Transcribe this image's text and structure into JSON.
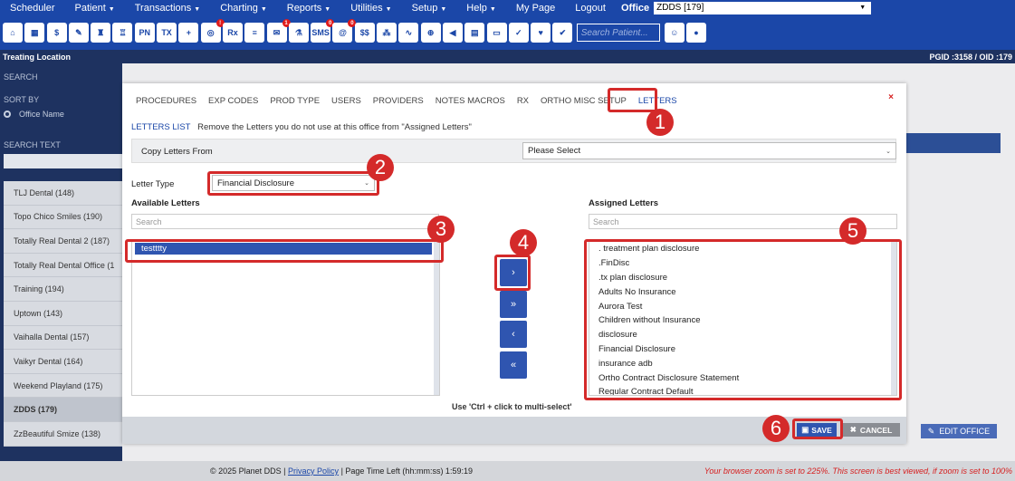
{
  "nav": {
    "items": [
      "Scheduler",
      "Patient",
      "Transactions",
      "Charting",
      "Reports",
      "Utilities",
      "Setup",
      "Help",
      "My Page",
      "Logout"
    ],
    "has_caret": [
      false,
      true,
      true,
      true,
      true,
      true,
      true,
      true,
      false,
      false
    ],
    "office_label": "Office",
    "office_value": "ZDDS [179]"
  },
  "toolbar": {
    "icons": [
      {
        "name": "home-icon",
        "glyph": "⌂"
      },
      {
        "name": "calendar-icon",
        "glyph": "▦"
      },
      {
        "name": "dollar-icon",
        "glyph": "$"
      },
      {
        "name": "edit-icon",
        "glyph": "✎"
      },
      {
        "name": "tooth-icon",
        "glyph": "♜"
      },
      {
        "name": "tooth-chart-icon",
        "glyph": "♖"
      },
      {
        "name": "pn-icon",
        "glyph": "PN"
      },
      {
        "name": "tx-icon",
        "glyph": "TX"
      },
      {
        "name": "add-person-icon",
        "glyph": "+"
      },
      {
        "name": "globe-icon",
        "glyph": "◎",
        "badge": "!"
      },
      {
        "name": "rx-icon",
        "glyph": "Rx"
      },
      {
        "name": "notes-icon",
        "glyph": "≡"
      },
      {
        "name": "messages-icon",
        "glyph": "✉",
        "badge": "1"
      },
      {
        "name": "lab-icon",
        "glyph": "⚗"
      },
      {
        "name": "sms-icon",
        "glyph": "SMS",
        "badge": "0"
      },
      {
        "name": "online-icon",
        "glyph": "@",
        "badge": "0"
      },
      {
        "name": "payments-icon",
        "glyph": "$$"
      },
      {
        "name": "network-icon",
        "glyph": "⁂"
      },
      {
        "name": "analytics-icon",
        "glyph": "∿"
      },
      {
        "name": "support-icon",
        "glyph": "⊕"
      },
      {
        "name": "marketing-icon",
        "glyph": "◀"
      },
      {
        "name": "print-icon",
        "glyph": "▤"
      },
      {
        "name": "document-icon",
        "glyph": "▭"
      },
      {
        "name": "verify-icon",
        "glyph": "✓"
      },
      {
        "name": "shield-icon",
        "glyph": "♥"
      },
      {
        "name": "check-mail-icon",
        "glyph": "✔"
      }
    ],
    "search_placeholder": "Search Patient...",
    "after_icons": [
      {
        "name": "patient-search-icon",
        "glyph": "☺"
      },
      {
        "name": "patient-lookup-icon",
        "glyph": "●"
      }
    ]
  },
  "header": {
    "title": "Treating Location",
    "ids": "PGID :3158  /  OID :179"
  },
  "sidebar": {
    "search_label": "SEARCH",
    "sort_label": "SORT BY",
    "sort_option": "Office Name",
    "search_text_label": "SEARCH TEXT",
    "items": [
      "TLJ Dental (148)",
      "Topo Chico Smiles (190)",
      "Totally Real Dental 2 (187)",
      "Totally Real Dental Office (1",
      "Training (194)",
      "Uptown (143)",
      "Vaihalla Dental (157)",
      "Vaikyr Dental (164)",
      "Weekend Playland (175)",
      "ZDDS (179)",
      "ZzBeautiful Smize (138)"
    ],
    "active_index": 9
  },
  "background": {
    "edit_office": "EDIT OFFICE"
  },
  "modal": {
    "tabs": [
      "PROCEDURES",
      "EXP CODES",
      "PROD TYPE",
      "USERS",
      "PROVIDERS",
      "NOTES MACROS",
      "RX",
      "ORTHO MISC SETUP",
      "LETTERS"
    ],
    "active_tab": 8,
    "close": "×",
    "list_label": "LETTERS LIST",
    "list_hint": "Remove the Letters you do not use at this office from \"Assigned Letters\"",
    "copy_from_label": "Copy Letters From",
    "copy_from_value": "Please Select",
    "letter_type_label": "Letter Type",
    "letter_type_value": "Financial Disclosure",
    "available_label": "Available Letters",
    "assigned_label": "Assigned Letters",
    "search_placeholder": "Search",
    "available_items": [
      "testttty"
    ],
    "assigned_items": [
      ". treatment plan disclosure",
      ".FinDisc",
      ".tx plan disclosure",
      "Adults No Insurance",
      "Aurora Test",
      "Children without Insurance",
      "disclosure",
      "Financial Disclosure",
      "insurance adb",
      "Ortho Contract Disclosure Statement",
      "Regular Contract Default"
    ],
    "move_buttons": [
      "›",
      "»",
      "‹",
      "«"
    ],
    "ctrl_note": "Use 'Ctrl + click to multi-select'",
    "save": "SAVE",
    "cancel": "CANCEL"
  },
  "annotations": [
    "1",
    "2",
    "3",
    "4",
    "5",
    "6"
  ],
  "footer": {
    "copyright": "© 2025 Planet DDS |",
    "privacy": "Privacy Policy",
    "time_left": "| Page Time Left (hh:mm:ss) 1:59:19",
    "zoom_warning": "Your browser zoom is set to 225%. This screen is best viewed, if zoom is set to 100%"
  },
  "colors": {
    "nav_blue": "#1b47a8",
    "sidebar_dark": "#1e3260",
    "annotation_red": "#d42a2a",
    "button_blue": "#2f55b0"
  }
}
